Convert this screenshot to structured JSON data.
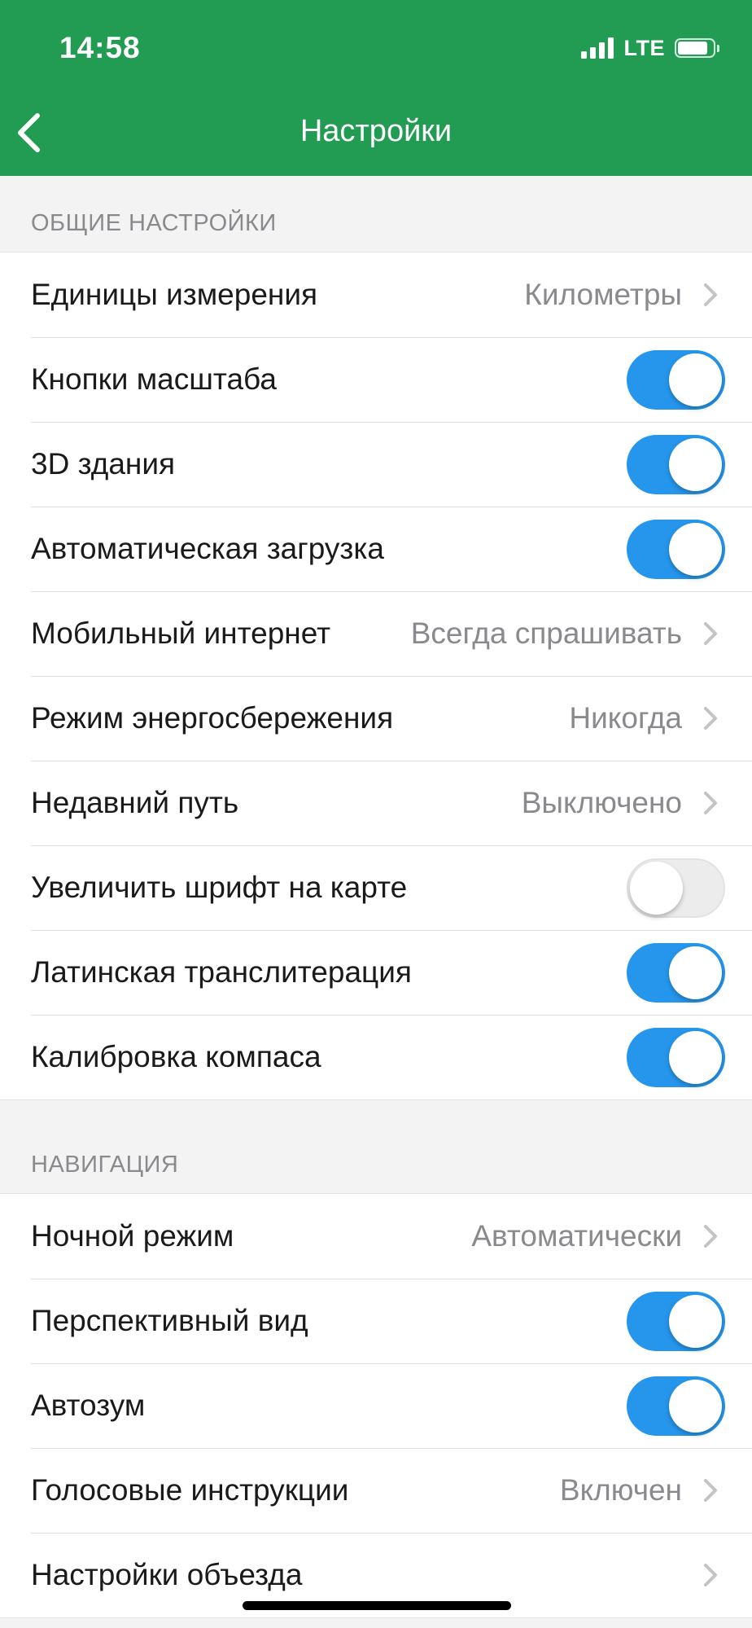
{
  "status_bar": {
    "time": "14:58",
    "network": "LTE"
  },
  "nav": {
    "title": "Настройки",
    "back_icon": "chevron-left-icon"
  },
  "colors": {
    "header": "#229b53",
    "toggle_on": "#2596ec",
    "toggle_off": "#ececec"
  },
  "sections": {
    "general": {
      "header": "ОБЩИЕ НАСТРОЙКИ",
      "items": [
        {
          "label": "Единицы измерения",
          "type": "disclosure",
          "value": "Километры"
        },
        {
          "label": "Кнопки масштаба",
          "type": "toggle",
          "on": true
        },
        {
          "label": "3D здания",
          "type": "toggle",
          "on": true
        },
        {
          "label": "Автоматическая загрузка",
          "type": "toggle",
          "on": true
        },
        {
          "label": "Мобильный интернет",
          "type": "disclosure",
          "value": "Всегда спрашивать"
        },
        {
          "label": "Режим энергосбережения",
          "type": "disclosure",
          "value": "Никогда"
        },
        {
          "label": "Недавний путь",
          "type": "disclosure",
          "value": "Выключено"
        },
        {
          "label": "Увеличить шрифт на карте",
          "type": "toggle",
          "on": false
        },
        {
          "label": "Латинская транслитерация",
          "type": "toggle",
          "on": true
        },
        {
          "label": "Калибровка компаса",
          "type": "toggle",
          "on": true
        }
      ]
    },
    "navigation": {
      "header": "НАВИГАЦИЯ",
      "items": [
        {
          "label": "Ночной режим",
          "type": "disclosure",
          "value": "Автоматически"
        },
        {
          "label": "Перспективный вид",
          "type": "toggle",
          "on": true
        },
        {
          "label": "Автозум",
          "type": "toggle",
          "on": true
        },
        {
          "label": "Голосовые инструкции",
          "type": "disclosure",
          "value": "Включен"
        },
        {
          "label": "Настройки объезда",
          "type": "disclosure",
          "value": ""
        }
      ]
    }
  }
}
